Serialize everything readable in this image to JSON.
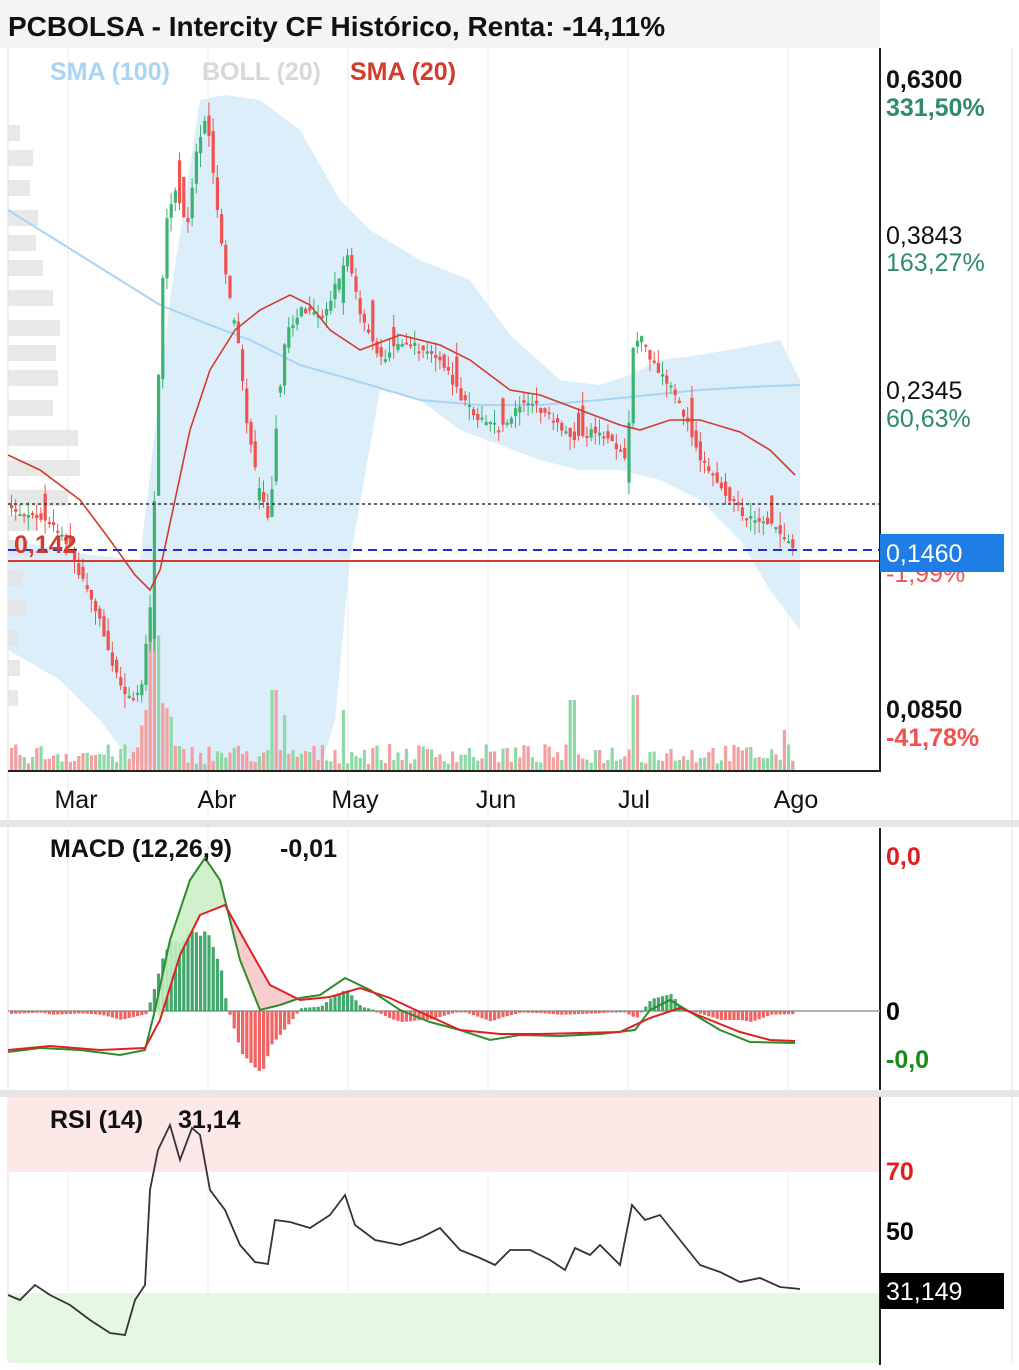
{
  "header": {
    "title": "PCBOLSA - Intercity CF Histórico, Renta: -14,11%"
  },
  "legend": [
    {
      "label": "SMA (100)",
      "color": "#a8d4f5"
    },
    {
      "label": "BOLL (20)",
      "color": "#d8d8d8"
    },
    {
      "label": "SMA (20)",
      "color": "#d23c2c"
    }
  ],
  "colors": {
    "up": "#3cb371",
    "down": "#ef5350",
    "band_fill": "#d6ebf9",
    "sma100": "#a8d4f5",
    "sma20": "#d23c2c",
    "macd": "#2e8b2e",
    "signal": "#e02020",
    "price_tag": "#1e7ee6",
    "rsi_line": "#333333",
    "overbought_fill": "#fde8e8",
    "oversold_fill": "#e5f9e2"
  },
  "price_axis": [
    {
      "price": "0,6300",
      "pct": "331,50%",
      "pct_color": "#2e8b6b",
      "bold": true
    },
    {
      "price": "0,3843",
      "pct": "163,27%",
      "pct_color": "#2e8b6b",
      "bold": false
    },
    {
      "price": "0,2345",
      "pct": "60,63%",
      "pct_color": "#2e8b6b",
      "bold": false
    },
    {
      "price": "0,0850",
      "pct": "-41,78%",
      "pct_color": "#ef5350",
      "bold": true
    }
  ],
  "current_price_tag": "0,1460",
  "current_pct_hidden": "-1,99%",
  "reference_price_label": "0,142",
  "x_axis_labels": [
    "Mar",
    "Abr",
    "May",
    "Jun",
    "Jul",
    "Ago"
  ],
  "macd_panel": {
    "title": "MACD (12,26,9)",
    "value": "-0,01",
    "axis": [
      {
        "label": "0,0",
        "color": "#e02020"
      },
      {
        "label": "0",
        "color": "#000000"
      },
      {
        "label": "-0,0",
        "color": "#1a8a1a"
      }
    ]
  },
  "rsi_panel": {
    "title": "RSI (14)",
    "value": "31,14",
    "axis": [
      {
        "label": "70",
        "color": "#e02020"
      },
      {
        "label": "50",
        "color": "#000000"
      }
    ],
    "current_tag": "31,149"
  },
  "chart_data": {
    "type": "candlestick",
    "title": "PCBOLSA - Intercity CF Histórico, Renta: -14,11%",
    "x_labels": [
      "Mar",
      "Abr",
      "May",
      "Jun",
      "Jul",
      "Ago"
    ],
    "y_scale": "log",
    "y_ticks": [
      0.63,
      0.3843,
      0.2345,
      0.085
    ],
    "current_price": 0.146,
    "reference_price": 0.142,
    "series": [
      {
        "name": "SMA (100)",
        "values": [
          0.35,
          0.33,
          0.31,
          0.29,
          0.275,
          0.262,
          0.25,
          0.242,
          0.236,
          0.233,
          0.232,
          0.233,
          0.236
        ]
      },
      {
        "name": "SMA (20)",
        "values": [
          0.19,
          0.17,
          0.13,
          0.14,
          0.23,
          0.3,
          0.29,
          0.27,
          0.27,
          0.245,
          0.225,
          0.22,
          0.215,
          0.19,
          0.17
        ]
      },
      {
        "name": "MACD (12,26,9)",
        "values": [
          -0.01,
          -0.01,
          0.02,
          0.05,
          0.02,
          0.0,
          0.004,
          -0.003,
          -0.008,
          -0.007,
          -0.006,
          0.002,
          -0.004,
          -0.01
        ]
      },
      {
        "name": "RSI (14)",
        "values": [
          40,
          38,
          30,
          25,
          35,
          85,
          90,
          70,
          55,
          60,
          65,
          57,
          52,
          50,
          55,
          52,
          55,
          52,
          65,
          60,
          48,
          42,
          38,
          31.14
        ]
      }
    ]
  }
}
